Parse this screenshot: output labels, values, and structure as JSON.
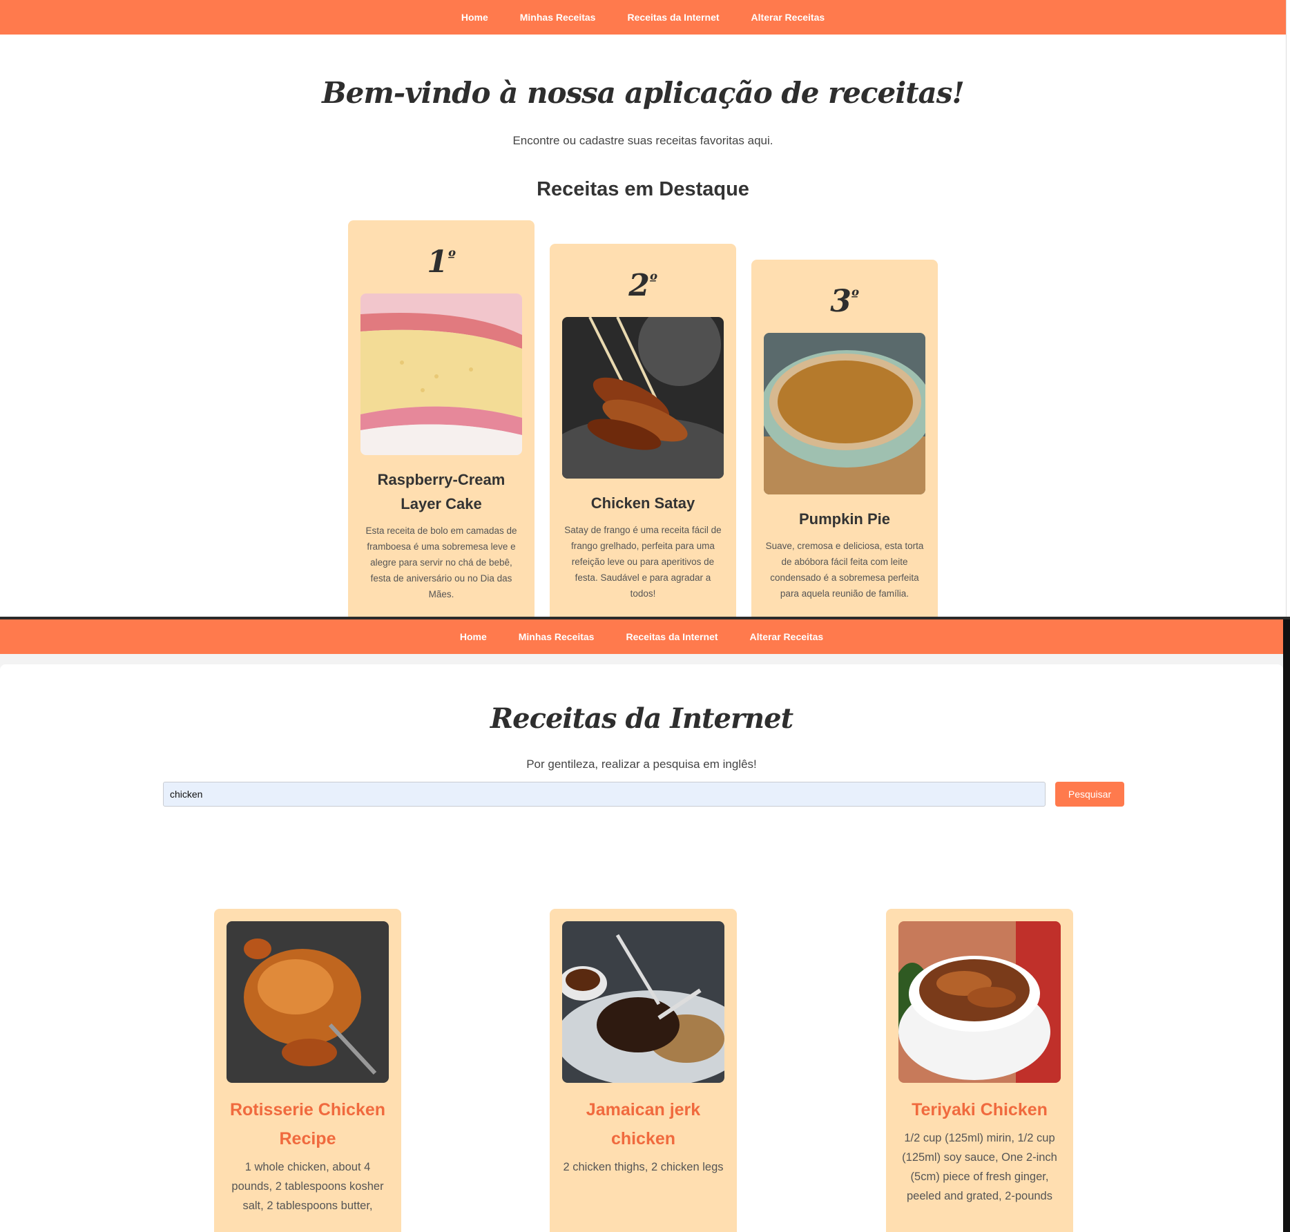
{
  "nav": {
    "items": [
      {
        "label": "Home"
      },
      {
        "label": "Minhas Receitas"
      },
      {
        "label": "Receitas da Internet"
      },
      {
        "label": "Alterar Receitas"
      }
    ],
    "color": "#ff7a4d"
  },
  "home": {
    "welcome": "Bem-vindo à nossa aplicação de receitas!",
    "subtitle": "Encontre ou cadastre suas receitas favoritas aqui.",
    "featured_title": "Receitas em Destaque",
    "featured": [
      {
        "rank": "1",
        "rank_suffix": "º",
        "name": "Raspberry-Cream Layer Cake",
        "description": "Esta receita de bolo em camadas de framboesa é uma sobremesa leve e alegre para servir no chá de bebê, festa de aniversário ou no Dia das Mães."
      },
      {
        "rank": "2",
        "rank_suffix": "º",
        "name": "Chicken Satay",
        "description": "Satay de frango é uma receita fácil de frango grelhado, perfeita para uma refeição leve ou para aperitivos de festa. Saudável e para agradar a todos!"
      },
      {
        "rank": "3",
        "rank_suffix": "º",
        "name": "Pumpkin Pie",
        "description": "Suave, cremosa e deliciosa, esta torta de abóbora fácil feita com leite condensado é a sobremesa perfeita para aquela reunião de família."
      }
    ]
  },
  "internet": {
    "title": "Receitas da Internet",
    "subtitle": "Por gentileza, realizar a pesquisa em inglês!",
    "search": {
      "value": "chicken",
      "button_label": "Pesquisar"
    },
    "results": [
      {
        "name": "Rotisserie Chicken Recipe",
        "ingredients": "1 whole chicken, about 4 pounds, 2 tablespoons kosher salt, 2 tablespoons butter,"
      },
      {
        "name": "Jamaican jerk chicken",
        "ingredients": "2 chicken thighs, 2 chicken legs"
      },
      {
        "name": "Teriyaki Chicken",
        "ingredients": "1/2 cup (125ml) mirin, 1/2 cup (125ml) soy sauce, One 2-inch (5cm) piece of fresh ginger, peeled and grated, 2-pounds"
      }
    ]
  },
  "colors": {
    "accent": "#ff7a4d",
    "card": "#ffdeb0",
    "result_title": "#f06a3e"
  }
}
